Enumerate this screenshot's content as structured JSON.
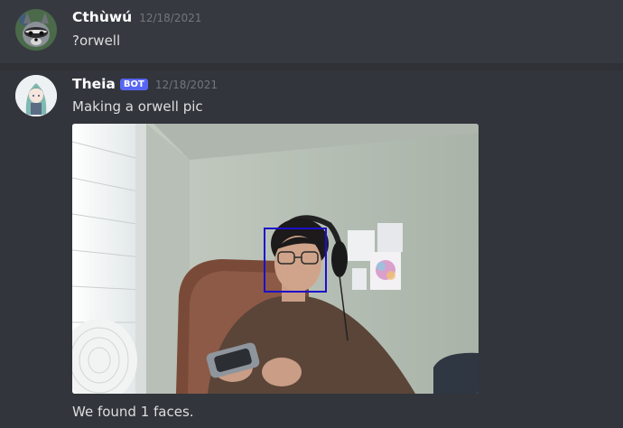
{
  "messages": [
    {
      "username": "Cthùwú",
      "timestamp": "12/18/2021",
      "text": "?orwell",
      "avatar": "raccoon-avatar"
    },
    {
      "username": "Theia",
      "bot_tag": "BOT",
      "timestamp": "12/18/2021",
      "text": "Making a orwell pic",
      "attachment": {
        "kind": "webcam-photo",
        "face_detections": 1
      },
      "followup": "We found 1 faces.",
      "avatar": "anime-character-avatar"
    }
  ],
  "colors": {
    "background": "#36393f",
    "username": "#ffffff",
    "bot_tag": "#5865f2",
    "timestamp": "#72767d",
    "face_box": "#1d10c9"
  }
}
